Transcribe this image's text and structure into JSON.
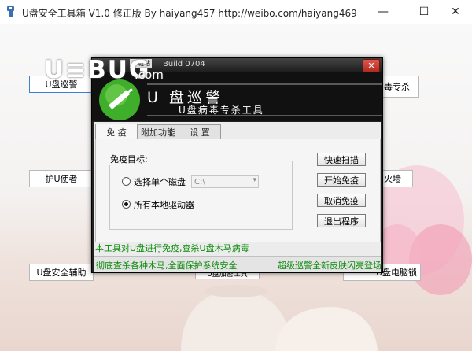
{
  "window": {
    "title": "U盘安全工具箱 V1.0 修正版    By haiyang457    http://weibo.com/haiyang469",
    "minimize": "—",
    "maximize": "☐",
    "close": "✕"
  },
  "background_buttons": {
    "usb_patrol": "U盘巡警",
    "virus_kill": "毒专杀",
    "usb_guard": "护U使者",
    "firewall": "火墙",
    "usb_assist": "U盘安全辅助",
    "mid": "U盘加密工具",
    "lock": "U盘电脑锁"
  },
  "watermark": {
    "brand": "U≡BUG",
    "domain": ".com"
  },
  "dialog": {
    "title_badge": "下载站",
    "title": "Build 0704",
    "close": "✕",
    "banner_title": "U 盘巡警",
    "banner_subtitle": "U盘病毒专杀工具",
    "tabs": [
      "免 疫",
      "附加功能",
      "设 置"
    ],
    "group_label": "免疫目标:",
    "radio_single": "选择单个磁盘",
    "drive_value": "C:\\",
    "radio_all": "所有本地驱动器",
    "buttons": {
      "quick_scan": "快速扫描",
      "start_immune": "开始免疫",
      "cancel_immune": "取消免疫",
      "exit": "退出程序"
    },
    "info_line": "本工具对U盘进行免疫,查杀U盘木马病毒",
    "status_left": "彻底查杀各种木马,全面保护系统安全",
    "status_right": "超级巡警全新皮肤闪亮登场"
  },
  "colors": {
    "status_green": "#0a8a0a",
    "dialog_dark": "#222222",
    "accent_green": "#3fae2a"
  }
}
